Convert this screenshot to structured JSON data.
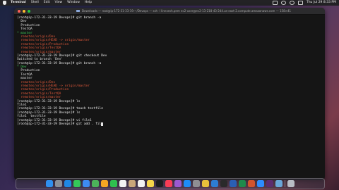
{
  "menubar": {
    "items": [
      "Terminal",
      "Shell",
      "Edit",
      "View",
      "Window",
      "Help"
    ],
    "clock": "Thu Jul 29  8:33 PM"
  },
  "window": {
    "title": "Downloads — root@ip-172-31-33-19:~/Devops — ssh -i linnsesh.pem ec2-user@ec2-13-218-43-244.us-east-2.compute.amazonaws.com — 158×41"
  },
  "terminal": {
    "lines": [
      {
        "text": "[root@ip-172-31-33-19 Devops]# git branch -a",
        "style": "prompt"
      },
      {
        "text": "  Dev",
        "style": "normal"
      },
      {
        "text": "  Production",
        "style": "normal"
      },
      {
        "text": "  TestQA",
        "style": "normal"
      },
      {
        "text": "* master",
        "style": "green"
      },
      {
        "text": "  remotes/origin/Dev",
        "style": "red"
      },
      {
        "text": "  remotes/origin/HEAD -> origin/master",
        "style": "red"
      },
      {
        "text": "  remotes/origin/Production",
        "style": "red"
      },
      {
        "text": "  remotes/origin/TestQA",
        "style": "red"
      },
      {
        "text": "  remotes/origin/master",
        "style": "red"
      },
      {
        "text": "[root@ip-172-31-33-19 Devops]# git checkout Dev",
        "style": "prompt"
      },
      {
        "text": "Switched to branch 'Dev'",
        "style": "normal"
      },
      {
        "text": "[root@ip-172-31-33-19 Devops]# git branch -a",
        "style": "prompt"
      },
      {
        "text": "* Dev",
        "style": "green"
      },
      {
        "text": "  Production",
        "style": "normal"
      },
      {
        "text": "  TestQA",
        "style": "normal"
      },
      {
        "text": "  master",
        "style": "normal"
      },
      {
        "text": "  remotes/origin/Dev",
        "style": "red"
      },
      {
        "text": "  remotes/origin/HEAD -> origin/master",
        "style": "red"
      },
      {
        "text": "  remotes/origin/Production",
        "style": "red"
      },
      {
        "text": "  remotes/origin/TestQA",
        "style": "red"
      },
      {
        "text": "  remotes/origin/master",
        "style": "red"
      },
      {
        "text": "[root@ip-172-31-33-19 Devops]# ls",
        "style": "prompt"
      },
      {
        "text": "file1",
        "style": "normal"
      },
      {
        "text": "[root@ip-172-31-33-19 Devops]# touch testfile",
        "style": "prompt"
      },
      {
        "text": "[root@ip-172-31-33-19 Devops]# ls",
        "style": "prompt"
      },
      {
        "text": "file1  testfile",
        "style": "normal"
      },
      {
        "text": "[root@ip-172-31-33-19 Devops]# vi file1",
        "style": "prompt"
      },
      {
        "text": "[root@ip-172-31-33-19 Devops]# git add . fil",
        "style": "prompt",
        "cursor": true
      }
    ]
  },
  "dock": {
    "icons": [
      {
        "name": "finder-icon",
        "color": "#2f8ff0"
      },
      {
        "name": "launchpad-icon",
        "color": "#8a8f98"
      },
      {
        "name": "safari-icon",
        "color": "#1e88e5"
      },
      {
        "name": "messages-icon",
        "color": "#34c759"
      },
      {
        "name": "mail-icon",
        "color": "#3d8bf2"
      },
      {
        "name": "maps-icon",
        "color": "#4cb35a"
      },
      {
        "name": "photos-icon",
        "color": "#f5a623"
      },
      {
        "name": "facetime-icon",
        "color": "#2fbf4f"
      },
      {
        "name": "calendar-icon",
        "color": "#f2f2f2"
      },
      {
        "name": "contacts-icon",
        "color": "#c9a67a"
      },
      {
        "name": "reminders-icon",
        "color": "#f2f2f2"
      },
      {
        "name": "notes-icon",
        "color": "#f7d54a"
      },
      {
        "name": "tv-icon",
        "color": "#1c1c1e"
      },
      {
        "name": "music-icon",
        "color": "#fa3c55"
      },
      {
        "name": "podcasts-icon",
        "color": "#9b59d0"
      },
      {
        "name": "app-store-icon",
        "color": "#1d8cf8"
      },
      {
        "name": "system-preferences-icon",
        "color": "#8e8e93"
      },
      {
        "name": "chrome-icon",
        "color": "#e9c13b"
      },
      {
        "name": "vscode-icon",
        "color": "#2d7dd2"
      },
      {
        "name": "terminal-icon",
        "color": "#2a2a2a"
      },
      {
        "name": "word-icon",
        "color": "#2b5fb4"
      },
      {
        "name": "excel-icon",
        "color": "#1f8a4c"
      },
      {
        "name": "powerpoint-icon",
        "color": "#d2542d"
      },
      {
        "name": "zoom-icon",
        "color": "#2d8cff"
      },
      {
        "name": "slack-icon",
        "color": "#5b2c6f"
      },
      {
        "name": "preview-icon",
        "color": "#6aa6d8"
      },
      {
        "name": "trash-icon",
        "color": "#b8bcc4"
      }
    ]
  }
}
